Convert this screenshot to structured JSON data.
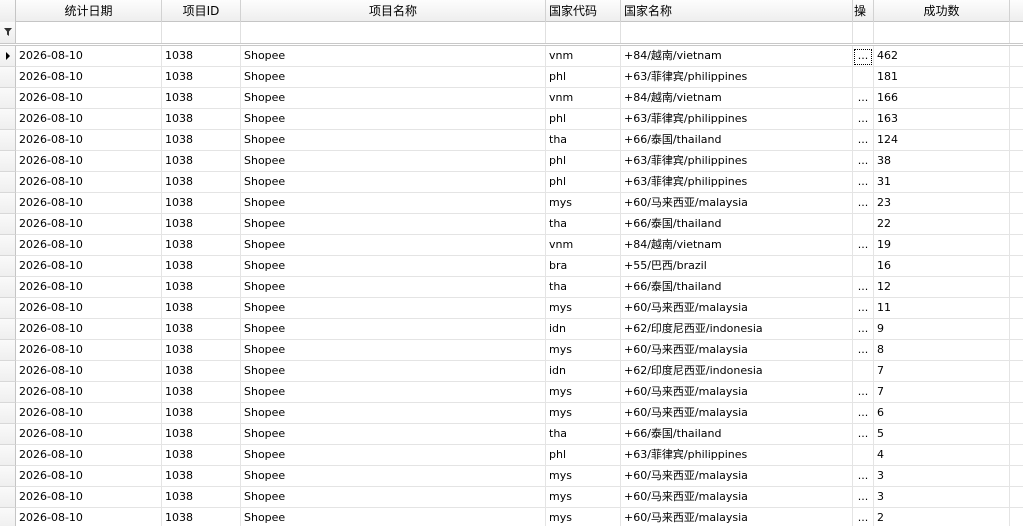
{
  "columns": {
    "date": "统计日期",
    "project_id": "项目ID",
    "project_name": "项目名称",
    "country_code": "国家代码",
    "country_name": "国家名称",
    "action": "操",
    "success_count": "成功数"
  },
  "icons": {
    "row_indicator": "current-row-arrow-icon",
    "filter": "filter-funnel-icon",
    "ellipsis": "ellipsis-button"
  },
  "rows": [
    {
      "date": "2026-08-10",
      "project_id": "1038",
      "project_name": "Shopee",
      "country_code": "vnm",
      "country_name": "+84/越南/vietnam",
      "action": "...",
      "success_count": "462"
    },
    {
      "date": "2026-08-10",
      "project_id": "1038",
      "project_name": "Shopee",
      "country_code": "phl",
      "country_name": "+63/菲律宾/philippines",
      "action": "",
      "success_count": "181"
    },
    {
      "date": "2026-08-10",
      "project_id": "1038",
      "project_name": "Shopee",
      "country_code": "vnm",
      "country_name": "+84/越南/vietnam",
      "action": "...",
      "success_count": "166"
    },
    {
      "date": "2026-08-10",
      "project_id": "1038",
      "project_name": "Shopee",
      "country_code": "phl",
      "country_name": "+63/菲律宾/philippines",
      "action": "...",
      "success_count": "163"
    },
    {
      "date": "2026-08-10",
      "project_id": "1038",
      "project_name": "Shopee",
      "country_code": "tha",
      "country_name": "+66/泰国/thailand",
      "action": "...",
      "success_count": "124"
    },
    {
      "date": "2026-08-10",
      "project_id": "1038",
      "project_name": "Shopee",
      "country_code": "phl",
      "country_name": "+63/菲律宾/philippines",
      "action": "...",
      "success_count": "38"
    },
    {
      "date": "2026-08-10",
      "project_id": "1038",
      "project_name": "Shopee",
      "country_code": "phl",
      "country_name": "+63/菲律宾/philippines",
      "action": "...",
      "success_count": "31"
    },
    {
      "date": "2026-08-10",
      "project_id": "1038",
      "project_name": "Shopee",
      "country_code": "mys",
      "country_name": "+60/马来西亚/malaysia",
      "action": "...",
      "success_count": "23"
    },
    {
      "date": "2026-08-10",
      "project_id": "1038",
      "project_name": "Shopee",
      "country_code": "tha",
      "country_name": "+66/泰国/thailand",
      "action": "",
      "success_count": "22"
    },
    {
      "date": "2026-08-10",
      "project_id": "1038",
      "project_name": "Shopee",
      "country_code": "vnm",
      "country_name": "+84/越南/vietnam",
      "action": "...",
      "success_count": "19"
    },
    {
      "date": "2026-08-10",
      "project_id": "1038",
      "project_name": "Shopee",
      "country_code": "bra",
      "country_name": "+55/巴西/brazil",
      "action": "",
      "success_count": "16"
    },
    {
      "date": "2026-08-10",
      "project_id": "1038",
      "project_name": "Shopee",
      "country_code": "tha",
      "country_name": "+66/泰国/thailand",
      "action": "...",
      "success_count": "12"
    },
    {
      "date": "2026-08-10",
      "project_id": "1038",
      "project_name": "Shopee",
      "country_code": "mys",
      "country_name": "+60/马来西亚/malaysia",
      "action": "...",
      "success_count": "11"
    },
    {
      "date": "2026-08-10",
      "project_id": "1038",
      "project_name": "Shopee",
      "country_code": "idn",
      "country_name": "+62/印度尼西亚/indonesia",
      "action": "...",
      "success_count": "9"
    },
    {
      "date": "2026-08-10",
      "project_id": "1038",
      "project_name": "Shopee",
      "country_code": "mys",
      "country_name": "+60/马来西亚/malaysia",
      "action": "...",
      "success_count": "8"
    },
    {
      "date": "2026-08-10",
      "project_id": "1038",
      "project_name": "Shopee",
      "country_code": "idn",
      "country_name": "+62/印度尼西亚/indonesia",
      "action": "",
      "success_count": "7"
    },
    {
      "date": "2026-08-10",
      "project_id": "1038",
      "project_name": "Shopee",
      "country_code": "mys",
      "country_name": "+60/马来西亚/malaysia",
      "action": "...",
      "success_count": "7"
    },
    {
      "date": "2026-08-10",
      "project_id": "1038",
      "project_name": "Shopee",
      "country_code": "mys",
      "country_name": "+60/马来西亚/malaysia",
      "action": "...",
      "success_count": "6"
    },
    {
      "date": "2026-08-10",
      "project_id": "1038",
      "project_name": "Shopee",
      "country_code": "tha",
      "country_name": "+66/泰国/thailand",
      "action": "...",
      "success_count": "5"
    },
    {
      "date": "2026-08-10",
      "project_id": "1038",
      "project_name": "Shopee",
      "country_code": "phl",
      "country_name": "+63/菲律宾/philippines",
      "action": "",
      "success_count": "4"
    },
    {
      "date": "2026-08-10",
      "project_id": "1038",
      "project_name": "Shopee",
      "country_code": "mys",
      "country_name": "+60/马来西亚/malaysia",
      "action": "...",
      "success_count": "3"
    },
    {
      "date": "2026-08-10",
      "project_id": "1038",
      "project_name": "Shopee",
      "country_code": "mys",
      "country_name": "+60/马来西亚/malaysia",
      "action": "...",
      "success_count": "3"
    },
    {
      "date": "2026-08-10",
      "project_id": "1038",
      "project_name": "Shopee",
      "country_code": "mys",
      "country_name": "+60/马来西亚/malaysia",
      "action": "...",
      "success_count": "2"
    }
  ]
}
